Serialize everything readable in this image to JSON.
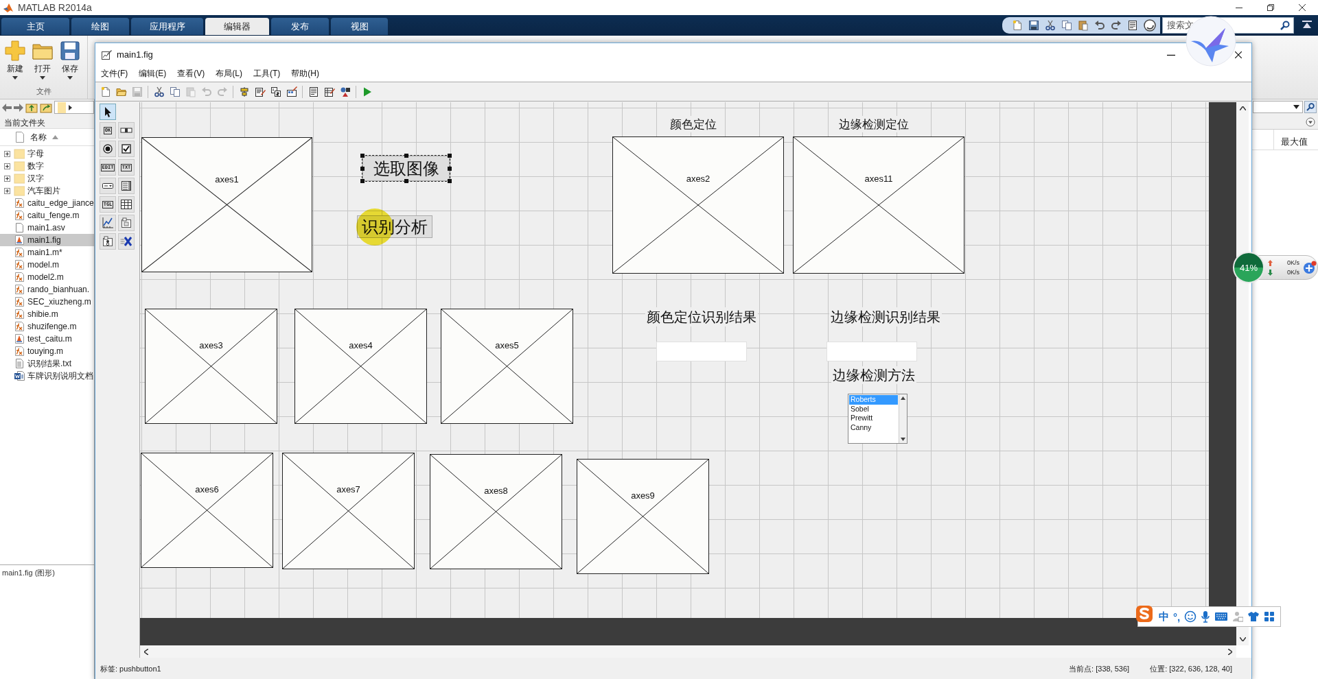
{
  "app": {
    "title": "MATLAB R2014a"
  },
  "ribbon": {
    "tabs": [
      {
        "label": "主页",
        "selected": false
      },
      {
        "label": "绘图",
        "selected": false
      },
      {
        "label": "应用程序",
        "selected": false
      },
      {
        "label": "编辑器",
        "selected": true
      },
      {
        "label": "发布",
        "selected": false
      },
      {
        "label": "视图",
        "selected": false
      }
    ],
    "buttons": [
      {
        "kind": "new",
        "label": "新建"
      },
      {
        "kind": "open",
        "label": "打开"
      },
      {
        "kind": "save",
        "label": "保存"
      }
    ],
    "section": "文件",
    "search": {
      "placeholder": "搜索文"
    }
  },
  "file_browser": {
    "title": "当前文件夹",
    "column": "名称",
    "items": [
      {
        "name": "字母",
        "kind": "folder",
        "selected": false
      },
      {
        "name": "数字",
        "kind": "folder",
        "selected": false
      },
      {
        "name": "汉字",
        "kind": "folder",
        "selected": false
      },
      {
        "name": "汽车图片",
        "kind": "folder",
        "selected": false
      },
      {
        "name": "caitu_edge_jiance",
        "kind": "function",
        "selected": false
      },
      {
        "name": "caitu_fenge.m",
        "kind": "function",
        "selected": false
      },
      {
        "name": "main1.asv",
        "kind": "blank",
        "selected": false
      },
      {
        "name": "main1.fig",
        "kind": "figure",
        "selected": true
      },
      {
        "name": "main1.m*",
        "kind": "function",
        "selected": false
      },
      {
        "name": "model.m",
        "kind": "function",
        "selected": false
      },
      {
        "name": "model2.m",
        "kind": "function",
        "selected": false
      },
      {
        "name": "rando_bianhuan.",
        "kind": "function",
        "selected": false
      },
      {
        "name": "SEC_xiuzheng.m",
        "kind": "function",
        "selected": false
      },
      {
        "name": "shibie.m",
        "kind": "function",
        "selected": false
      },
      {
        "name": "shuzifenge.m",
        "kind": "function",
        "selected": false
      },
      {
        "name": "test_caitu.m",
        "kind": "figure",
        "selected": false
      },
      {
        "name": "touying.m",
        "kind": "function",
        "selected": false
      },
      {
        "name": "识别结果.txt",
        "kind": "text",
        "selected": false
      },
      {
        "name": "车牌识别说明文档",
        "kind": "word",
        "selected": false
      }
    ],
    "details": "main1.fig (图形)"
  },
  "workspace": {
    "column": "最大值"
  },
  "figure_window": {
    "title": "main1.fig",
    "menu": [
      "文件(F)",
      "编辑(E)",
      "查看(V)",
      "布局(L)",
      "工具(T)",
      "帮助(H)"
    ],
    "toolbar": [
      {
        "kind": "new",
        "disabled": false
      },
      {
        "kind": "open",
        "disabled": false
      },
      {
        "kind": "save",
        "disabled": true
      },
      {
        "kind": "cut",
        "disabled": false
      },
      {
        "kind": "copy",
        "disabled": false
      },
      {
        "kind": "paste",
        "disabled": true
      },
      {
        "kind": "undo",
        "disabled": true
      },
      {
        "kind": "redo",
        "disabled": true
      },
      {
        "kind": "align",
        "disabled": false
      },
      {
        "kind": "menu_editor",
        "disabled": false
      },
      {
        "kind": "tab_order",
        "disabled": false
      },
      {
        "kind": "toolbar_editor",
        "disabled": false
      },
      {
        "kind": "editor",
        "disabled": false
      },
      {
        "kind": "inspector",
        "disabled": false
      },
      {
        "kind": "browser",
        "disabled": false
      },
      {
        "kind": "run",
        "disabled": false
      }
    ],
    "palette": [
      {
        "kind": "select",
        "selected": true
      },
      {
        "kind": "pushbutton",
        "glyph": "OK",
        "selected": false
      },
      {
        "kind": "slider",
        "selected": false
      },
      {
        "kind": "radio",
        "selected": false
      },
      {
        "kind": "checkbox",
        "selected": false
      },
      {
        "kind": "edit",
        "glyph": "EDIT",
        "selected": false
      },
      {
        "kind": "text",
        "glyph": "TXT",
        "selected": false
      },
      {
        "kind": "popup",
        "selected": false
      },
      {
        "kind": "listbox",
        "selected": false
      },
      {
        "kind": "toggle",
        "glyph": "TGL",
        "selected": false
      },
      {
        "kind": "table",
        "selected": false
      },
      {
        "kind": "axes",
        "selected": false
      },
      {
        "kind": "panel",
        "selected": false
      },
      {
        "kind": "buttongroup",
        "selected": false
      },
      {
        "kind": "activex",
        "selected": false
      }
    ],
    "components": [
      {
        "kind": "axes",
        "label": "axes1",
        "selected": false
      },
      {
        "kind": "pushbutton",
        "label": "选取图像",
        "selected": true
      },
      {
        "kind": "text",
        "label": "颜色定位",
        "selected": false
      },
      {
        "kind": "text",
        "label": "边缘检测定位",
        "selected": false
      },
      {
        "kind": "axes",
        "label": "axes2",
        "selected": false
      },
      {
        "kind": "axes",
        "label": "axes11",
        "selected": false
      },
      {
        "kind": "pushbutton",
        "label": "识别分析",
        "selected": false
      },
      {
        "kind": "axes",
        "label": "axes3",
        "selected": false
      },
      {
        "kind": "axes",
        "label": "axes4",
        "selected": false
      },
      {
        "kind": "axes",
        "label": "axes5",
        "selected": false
      },
      {
        "kind": "text",
        "label": "颜色定位识别结果",
        "selected": false
      },
      {
        "kind": "text",
        "label": "边缘检测识别结果",
        "selected": false
      },
      {
        "kind": "edit",
        "selected": false
      },
      {
        "kind": "edit",
        "selected": false
      },
      {
        "kind": "text",
        "label": "边缘检测方法",
        "selected": false
      },
      {
        "kind": "listbox",
        "selected": false,
        "items": [
          {
            "label": "Roberts",
            "selected": true
          },
          {
            "label": "Sobel",
            "selected": false
          },
          {
            "label": "Prewitt",
            "selected": false
          },
          {
            "label": "Canny",
            "selected": false
          }
        ]
      },
      {
        "kind": "axes",
        "label": "axes6",
        "selected": false
      },
      {
        "kind": "axes",
        "label": "axes7",
        "selected": false
      },
      {
        "kind": "axes",
        "label": "axes8",
        "selected": false
      },
      {
        "kind": "axes",
        "label": "axes9",
        "selected": false
      }
    ],
    "status": {
      "tag": "标签: pushbutton1",
      "current_point": "当前点:  [338, 536]",
      "position": "位置: [322, 636, 128, 40]"
    }
  },
  "network_monitor": {
    "percent": "41%",
    "upload": "0K/s",
    "download": "0K/s"
  },
  "ime_bar": {
    "items": [
      "中",
      "°,"
    ]
  }
}
